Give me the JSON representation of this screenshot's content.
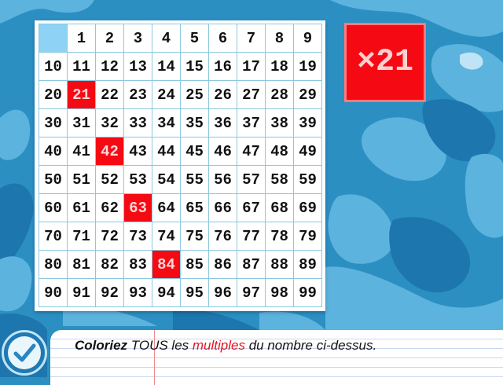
{
  "header_blank": "",
  "column_headers": [
    "1",
    "2",
    "3",
    "4",
    "5",
    "6",
    "7",
    "8",
    "9"
  ],
  "rows": [
    [
      "10",
      "11",
      "12",
      "13",
      "14",
      "15",
      "16",
      "17",
      "18",
      "19"
    ],
    [
      "20",
      "21",
      "22",
      "23",
      "24",
      "25",
      "26",
      "27",
      "28",
      "29"
    ],
    [
      "30",
      "31",
      "32",
      "33",
      "34",
      "35",
      "36",
      "37",
      "38",
      "39"
    ],
    [
      "40",
      "41",
      "42",
      "43",
      "44",
      "45",
      "46",
      "47",
      "48",
      "49"
    ],
    [
      "50",
      "51",
      "52",
      "53",
      "54",
      "55",
      "56",
      "57",
      "58",
      "59"
    ],
    [
      "60",
      "61",
      "62",
      "63",
      "64",
      "65",
      "66",
      "67",
      "68",
      "69"
    ],
    [
      "70",
      "71",
      "72",
      "73",
      "74",
      "75",
      "76",
      "77",
      "78",
      "79"
    ],
    [
      "80",
      "81",
      "82",
      "83",
      "84",
      "85",
      "86",
      "87",
      "88",
      "89"
    ],
    [
      "90",
      "91",
      "92",
      "93",
      "94",
      "95",
      "96",
      "97",
      "98",
      "99"
    ]
  ],
  "colored_numbers": [
    "21",
    "42",
    "63",
    "84"
  ],
  "factor_label": "×21",
  "instruction": {
    "word1": "Coloriez",
    "word2": " TOUS les ",
    "word3": "multiples",
    "word4": " du nombre ci-dessus."
  },
  "check_button_icon": "checkmark-icon",
  "colors": {
    "background": "#2b8fc2",
    "highlight": "#f50a14",
    "header_blank": "#8ed2f5",
    "grid_line": "#8cc8e0"
  }
}
